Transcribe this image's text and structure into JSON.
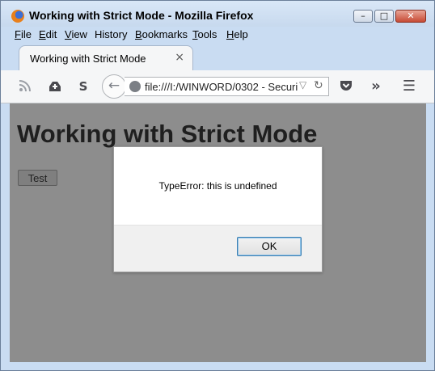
{
  "window": {
    "title": "Working with Strict Mode - Mozilla Firefox",
    "controls": {
      "minimize": "▭",
      "maximize": "□",
      "close": "✕"
    }
  },
  "menu": [
    {
      "label": "File",
      "mnemonic": "F",
      "rest": "ile"
    },
    {
      "label": "Edit",
      "mnemonic": "E",
      "rest": "dit"
    },
    {
      "label": "View",
      "mnemonic": "V",
      "rest": "iew"
    },
    {
      "label": "History",
      "mnemonic": "",
      "rest": "History"
    },
    {
      "label": "Bookmarks",
      "mnemonic": "B",
      "rest": "ookmarks"
    },
    {
      "label": "Tools",
      "mnemonic": "T",
      "rest": "ools"
    },
    {
      "label": "Help",
      "mnemonic": "H",
      "rest": "elp"
    }
  ],
  "tab": {
    "label": "Working with Strict Mode",
    "close": "×"
  },
  "navbar": {
    "icons": [
      "rss-icon",
      "upload-icon",
      "s-icon",
      "back-arrow-icon",
      "globe-icon",
      "pocket-icon",
      "overflow-icon",
      "hamburger-icon"
    ],
    "url": "file:///I:/WINWORD/0302 - Securi",
    "back": "←",
    "reload": "↻",
    "dropdown": "▽",
    "overflow": "»",
    "hamburger": "☰"
  },
  "page": {
    "heading": "Working with Strict Mode",
    "button": "Test"
  },
  "dialog": {
    "message": "TypeError: this is undefined",
    "ok": "OK"
  }
}
